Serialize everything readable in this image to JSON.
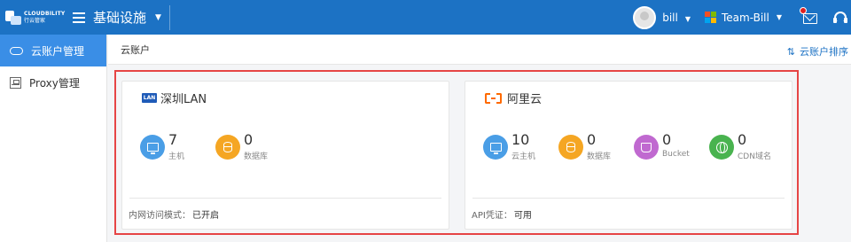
{
  "brand": {
    "name_en": "CLOUDBILITY",
    "name_cn": "行云管家"
  },
  "header": {
    "module": "基础设施",
    "user": "bill",
    "team": "Team-Bill"
  },
  "icons": {
    "menu": "hamburger-icon",
    "mail": "mail-icon",
    "support": "headset-icon"
  },
  "sidebar": {
    "items": [
      {
        "label": "云账户管理",
        "active": true,
        "icon": "cloud-icon"
      },
      {
        "label": "Proxy管理",
        "active": false,
        "icon": "proxy-icon"
      }
    ]
  },
  "breadcrumb": "云账户",
  "sort_label": "云账户排序",
  "colors": {
    "brand": "#1c72c4",
    "active": "#3a8ee6",
    "highlight": "#e64545",
    "aliyun": "#ff6a00"
  },
  "accounts": [
    {
      "name": "深圳LAN",
      "badge": "LAN",
      "stats": [
        {
          "value": "7",
          "label": "主机",
          "icon": "monitor-icon"
        },
        {
          "value": "0",
          "label": "数据库",
          "icon": "database-icon"
        }
      ],
      "footer_label": "内网访问模式：",
      "footer_value": "已开启"
    },
    {
      "name": "阿里云",
      "badge": "aliyun-logo",
      "stats": [
        {
          "value": "10",
          "label": "云主机",
          "icon": "monitor-icon"
        },
        {
          "value": "0",
          "label": "数据库",
          "icon": "database-icon"
        },
        {
          "value": "0",
          "label": "Bucket",
          "icon": "bucket-icon"
        },
        {
          "value": "0",
          "label": "CDN域名",
          "icon": "globe-icon"
        }
      ],
      "footer_label": "API凭证：",
      "footer_value": "可用"
    }
  ]
}
